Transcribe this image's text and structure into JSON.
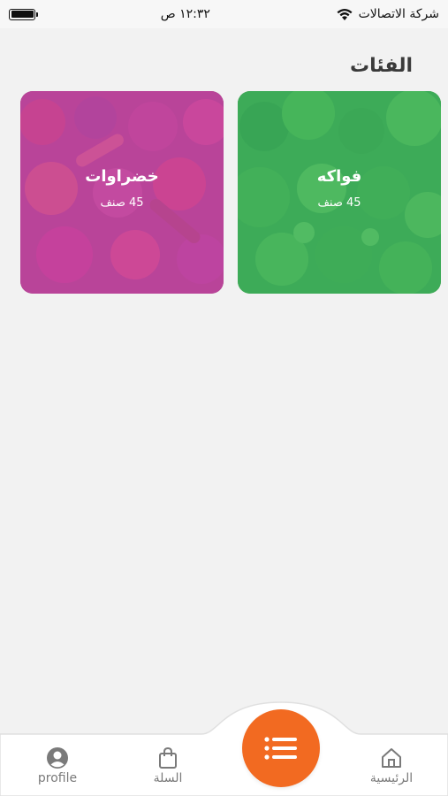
{
  "status_bar": {
    "carrier": "شركة الاتصالات",
    "time": "١٢:٣٢ ص"
  },
  "page": {
    "title": "الفئات"
  },
  "categories": [
    {
      "name": "فواكه",
      "count": "45 صنف",
      "overlay_color": "#3ab262"
    },
    {
      "name": "خضراوات",
      "count": "45 صنف",
      "overlay_color": "#c646aa"
    }
  ],
  "bottom_nav": {
    "profile_label": "profile",
    "cart_label": "السلة",
    "home_label": "الرئيسية",
    "center_icon": "menu-list-icon",
    "accent_color": "#f26a21"
  }
}
